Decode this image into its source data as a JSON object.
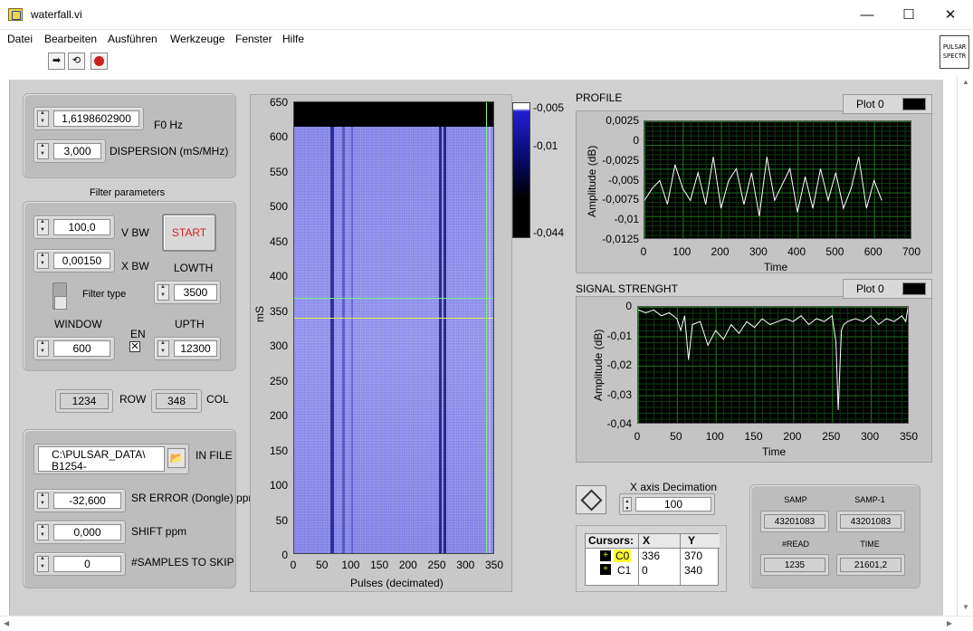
{
  "window": {
    "title": "waterfall.vi",
    "minimize": "—",
    "maximize": "☐",
    "close": "✕"
  },
  "menu": [
    "Datei",
    "Bearbeiten",
    "Ausführen",
    "Werkzeuge",
    "Fenster",
    "Hilfe"
  ],
  "logo": {
    "line1": "PULSAR",
    "line2": "SPECTR"
  },
  "controls": {
    "f0": {
      "value": "1,6198602900",
      "label": "F0 Hz"
    },
    "dispersion": {
      "value": "3,000",
      "label": "DISPERSION (mS/MHz)"
    },
    "filter_title": "Filter parameters",
    "vbw": {
      "value": "100,0",
      "label": "V BW"
    },
    "xbw": {
      "value": "0,00150",
      "label": "X BW"
    },
    "start": "START",
    "lowth": {
      "value": "3500",
      "label": "LOWTH"
    },
    "filter_type": "Filter type",
    "window": {
      "value": "600",
      "label": "WINDOW"
    },
    "en": {
      "label": "EN",
      "mark": "✕"
    },
    "upth": {
      "value": "12300",
      "label": "UPTH"
    },
    "row": {
      "value": "1234",
      "label": "ROW"
    },
    "col": {
      "value": "348",
      "label": "COL"
    },
    "in_file": {
      "value_line1": "C:\\PULSAR_DATA\\",
      "value_line2": "B1254-",
      "label": "IN FILE"
    },
    "sr_error": {
      "value": "-32,600",
      "label": "SR ERROR (Dongle) ppm"
    },
    "shift": {
      "value": "0,000",
      "label": "SHIFT ppm"
    },
    "skip": {
      "value": "0",
      "label": "#SAMPLES TO SKIP"
    }
  },
  "waterfall": {
    "ylabel": "mS",
    "xlabel": "Pulses (decimated)",
    "yticks": [
      "650",
      "600",
      "550",
      "500",
      "450",
      "400",
      "350",
      "300",
      "250",
      "200",
      "150",
      "100",
      "50",
      "0"
    ],
    "xticks": [
      "0",
      "50",
      "100",
      "150",
      "200",
      "250",
      "300",
      "350"
    ],
    "colorbar_ticks": [
      "-0,005",
      "-0,01",
      "-0,044"
    ]
  },
  "profile": {
    "title": "PROFILE",
    "legend": "Plot 0",
    "ylabel": "Amplitude (dB)",
    "xlabel": "Time",
    "yticks": [
      "0,0025",
      "0",
      "-0,0025",
      "-0,005",
      "-0,0075",
      "-0,01",
      "-0,0125"
    ],
    "xticks": [
      "0",
      "100",
      "200",
      "300",
      "400",
      "500",
      "600",
      "700"
    ]
  },
  "signal": {
    "title": "SIGNAL STRENGHT",
    "legend": "Plot 0",
    "ylabel": "Amplitude (dB)",
    "xlabel": "Time",
    "yticks": [
      "0",
      "-0,01",
      "-0,02",
      "-0,03",
      "-0,04"
    ],
    "xticks": [
      "0",
      "50",
      "100",
      "150",
      "200",
      "250",
      "300",
      "350"
    ]
  },
  "decimation": {
    "label": "X axis Decimation",
    "value": "100"
  },
  "cursors": {
    "headers": [
      "Cursors:",
      "X",
      "Y"
    ],
    "rows": [
      {
        "name": "C0",
        "x": "336",
        "y": "370"
      },
      {
        "name": "C1",
        "x": "0",
        "y": "340"
      }
    ]
  },
  "samp": {
    "samp": {
      "label": "SAMP",
      "value": "43201083"
    },
    "samp1": {
      "label": "SAMP-1",
      "value": "43201083"
    },
    "read": {
      "label": "#READ",
      "value": "1235"
    },
    "time": {
      "label": "TIME",
      "value": "21601,2"
    }
  },
  "chart_data": [
    {
      "type": "heatmap",
      "title": "",
      "xlabel": "Pulses (decimated)",
      "ylabel": "mS",
      "xlim": [
        0,
        350
      ],
      "ylim": [
        0,
        650
      ],
      "colorbar": [
        -0.044,
        -0.005
      ],
      "cursors": [
        {
          "x": 336,
          "y": 370
        },
        {
          "x": 0,
          "y": 340
        }
      ]
    },
    {
      "type": "line",
      "title": "PROFILE",
      "xlabel": "Time",
      "ylabel": "Amplitude (dB)",
      "xlim": [
        0,
        700
      ],
      "ylim": [
        -0.0125,
        0.0025
      ],
      "series": [
        {
          "name": "Plot 0",
          "x": [
            0,
            20,
            40,
            60,
            80,
            100,
            120,
            140,
            160,
            180,
            200,
            220,
            240,
            260,
            280,
            300,
            320,
            340,
            360,
            380,
            400,
            420,
            440,
            460,
            480,
            500,
            520,
            540,
            560,
            580,
            600,
            620
          ],
          "y": [
            -0.0075,
            -0.006,
            -0.005,
            -0.008,
            -0.003,
            -0.006,
            -0.0075,
            -0.004,
            -0.008,
            -0.002,
            -0.0085,
            -0.005,
            -0.0035,
            -0.008,
            -0.004,
            -0.0095,
            -0.002,
            -0.0075,
            -0.0055,
            -0.0035,
            -0.009,
            -0.0045,
            -0.0085,
            -0.0035,
            -0.0075,
            -0.004,
            -0.0085,
            -0.006,
            -0.002,
            -0.0085,
            -0.005,
            -0.0075
          ]
        }
      ]
    },
    {
      "type": "line",
      "title": "SIGNAL STRENGHT",
      "xlabel": "Time",
      "ylabel": "Amplitude (dB)",
      "xlim": [
        0,
        350
      ],
      "ylim": [
        -0.04,
        0
      ],
      "series": [
        {
          "name": "Plot 0",
          "x": [
            0,
            10,
            20,
            30,
            40,
            50,
            55,
            60,
            65,
            70,
            80,
            90,
            100,
            110,
            120,
            130,
            140,
            150,
            160,
            170,
            180,
            190,
            200,
            210,
            220,
            230,
            240,
            250,
            255,
            258,
            262,
            265,
            270,
            280,
            290,
            300,
            310,
            320,
            330,
            340,
            345,
            348
          ],
          "y": [
            -0.001,
            -0.002,
            -0.001,
            -0.003,
            -0.002,
            -0.004,
            -0.008,
            -0.003,
            -0.018,
            -0.006,
            -0.005,
            -0.013,
            -0.008,
            -0.011,
            -0.006,
            -0.009,
            -0.005,
            -0.007,
            -0.004,
            -0.006,
            -0.005,
            -0.004,
            -0.005,
            -0.003,
            -0.006,
            -0.004,
            -0.005,
            -0.003,
            -0.012,
            -0.035,
            -0.008,
            -0.006,
            -0.005,
            -0.004,
            -0.005,
            -0.003,
            -0.006,
            -0.004,
            -0.005,
            -0.003,
            -0.005,
            0
          ]
        }
      ]
    }
  ]
}
